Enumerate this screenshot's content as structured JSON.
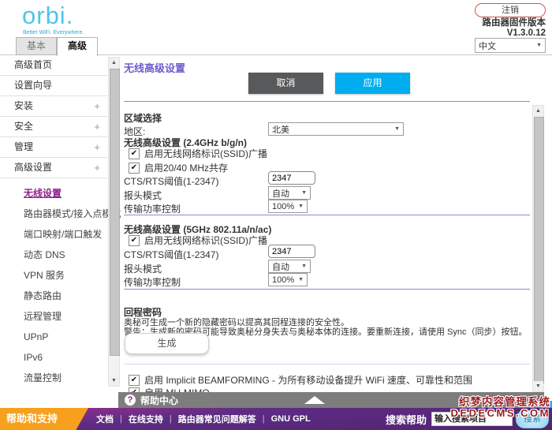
{
  "header": {
    "logo": "orbi.",
    "tagline": "Better WiFi. Everywhere.",
    "logout": "注销",
    "firmware_label": "路由器固件版本",
    "firmware_version": "V1.3.0.12",
    "language": "中文"
  },
  "tabs": {
    "basic": "基本",
    "advanced": "高级"
  },
  "sidebar": {
    "items": [
      "高级首页",
      "设置向导",
      "安装",
      "安全",
      "管理",
      "高级设置"
    ],
    "subitems": [
      "无线设置",
      "路由器模式/接入点模式",
      "端口映射/端口触发",
      "动态 DNS",
      "VPN 服务",
      "静态路由",
      "远程管理",
      "UPnP",
      "IPv6",
      "流量控制"
    ]
  },
  "main": {
    "title": "无线高级设置",
    "cancel": "取消",
    "apply": "应用",
    "region": {
      "heading": "区域选择",
      "label": "地区:",
      "value": "北美"
    },
    "band24": {
      "heading": "无线高级设置 (2.4GHz b/g/n)",
      "cb_ssid": "启用无线网络标识(SSID)广播",
      "cb_coex": "启用20/40 MHz共存",
      "cts_label": "CTS/RTS阈值(1-2347)",
      "cts_value": "2347",
      "preamble_label": "报头模式",
      "preamble_value": "自动",
      "power_label": "传输功率控制",
      "power_value": "100%"
    },
    "band5": {
      "heading": "无线高级设置 (5GHz 802.11a/n/ac)",
      "cb_ssid": "启用无线网络标识(SSID)广播",
      "cts_label": "CTS/RTS阈值(1-2347)",
      "cts_value": "2347",
      "preamble_label": "报头模式",
      "preamble_value": "自动",
      "power_label": "传输功率控制",
      "power_value": "100%"
    },
    "backhaul": {
      "heading": "回程密码",
      "desc": "奥秘可生成一个新的隐藏密码以提高其回程连接的安全性。",
      "warning": "警告：生成新的密码可能导致奥秘分身失去与奥秘本体的连接。要重新连接，请使用 Sync（同步）按钮。",
      "generate": "生成"
    },
    "cb_beamforming": "启用 Implicit BEAMFORMING - 为所有移动设备提升 WiFi 速度、可靠性和范围",
    "cb_mumimo": "启用 MU-MIMO"
  },
  "helpbar": {
    "icon": "?",
    "label": "帮助中心",
    "toggle": "显示/隐藏帮助中心"
  },
  "footer": {
    "support": "帮助和支持",
    "links": [
      "文档",
      "在线支持",
      "路由器常见问题解答",
      "GNU GPL"
    ],
    "separator": "|",
    "search_label": "搜索帮助",
    "search_placeholder": "输入搜索项目",
    "search_button": "搜索"
  },
  "watermark": {
    "line1": "织梦内容管理系统",
    "line2": "DEDECMS.COM"
  },
  "icons": {
    "chevron_down": "▼",
    "check": "✔",
    "plus": "+",
    "scroll_up": "▲",
    "scroll_down": "▼"
  },
  "colors": {
    "title_purple": "#6c5ecf",
    "divider_purple": "#8f86e0",
    "apply_cyan": "#00aeef",
    "cancel_gray": "#58595b",
    "sidebar_active": "#8b1f8b",
    "footer_purple": "#5c2c83",
    "footer_orange": "#f7a01d",
    "logo_blue": "#4fc4e8",
    "helpbar_gray": "#7d7d7d",
    "watermark_red": "#9b1b1b"
  }
}
